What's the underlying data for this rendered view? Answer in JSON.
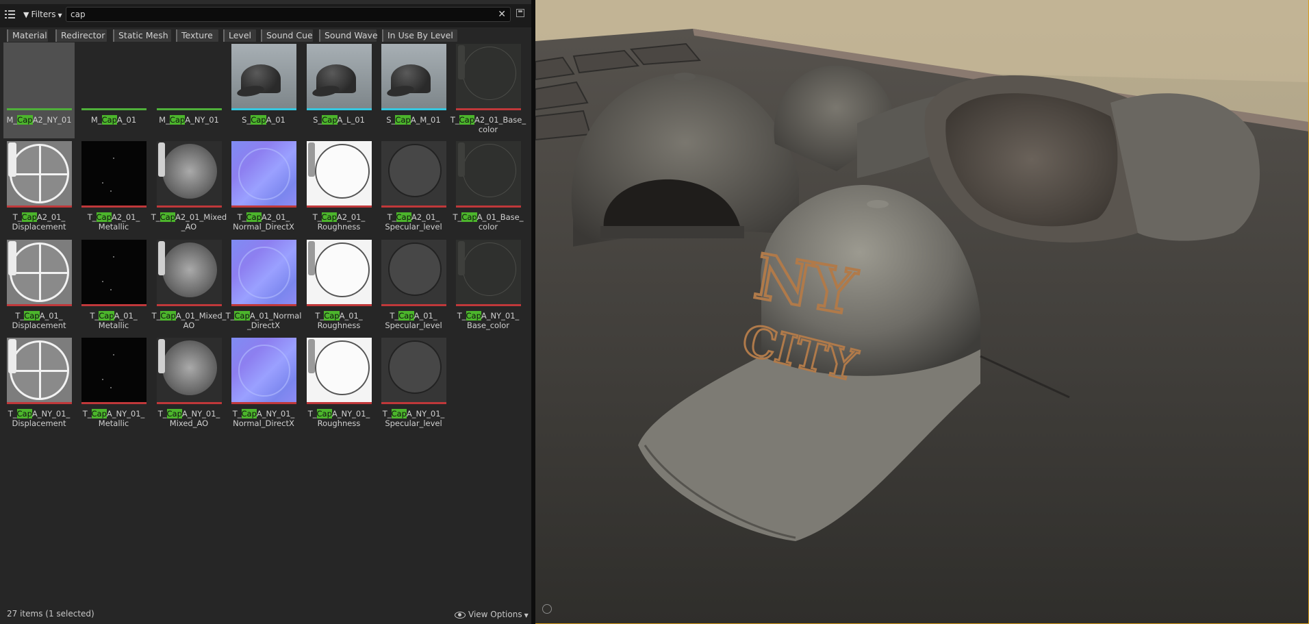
{
  "toolbar": {
    "filters_label": "Filters",
    "search_value": "cap",
    "search_placeholder": ""
  },
  "filter_chips": [
    {
      "label": "Material"
    },
    {
      "label": "Redirector"
    },
    {
      "label": "Static Mesh"
    },
    {
      "label": "Texture"
    },
    {
      "label": "Level"
    },
    {
      "label": "Sound Cue"
    },
    {
      "label": "Sound Wave"
    },
    {
      "label": "In Use By Level"
    }
  ],
  "assets": [
    {
      "pre": "M_",
      "match": "Cap",
      "post": "A2_NY_01",
      "thumb": "material",
      "bar": "#4fb03a",
      "selected": true
    },
    {
      "pre": "M_",
      "match": "Cap",
      "post": "A_01",
      "thumb": "material",
      "bar": "#4fb03a"
    },
    {
      "pre": "M_",
      "match": "Cap",
      "post": "A_NY_01",
      "thumb": "material",
      "bar": "#4fb03a"
    },
    {
      "pre": "S_",
      "match": "Cap",
      "post": "A_01",
      "thumb": "mesh",
      "bar": "#35c8e0"
    },
    {
      "pre": "S_",
      "match": "Cap",
      "post": "A_L_01",
      "thumb": "mesh",
      "bar": "#35c8e0"
    },
    {
      "pre": "S_",
      "match": "Cap",
      "post": "A_M_01",
      "thumb": "mesh",
      "bar": "#35c8e0"
    },
    {
      "pre": "T_",
      "match": "Cap",
      "post": "A2_01_Base_\ncolor",
      "thumb": "base",
      "bar": "#c0383a"
    },
    {
      "pre": "T_",
      "match": "Cap",
      "post": "A2_01_\nDisplacement",
      "thumb": "disp",
      "bar": "#c0383a"
    },
    {
      "pre": "T_",
      "match": "Cap",
      "post": "A2_01_\nMetallic",
      "thumb": "black",
      "bar": "#c0383a"
    },
    {
      "pre": "T_",
      "match": "Cap",
      "post": "A2_01_Mixed\n_AO",
      "thumb": "ao",
      "bar": "#c0383a"
    },
    {
      "pre": "T_",
      "match": "Cap",
      "post": "A2_01_\nNormal_DirectX",
      "thumb": "normal",
      "bar": "#c0383a"
    },
    {
      "pre": "T_",
      "match": "Cap",
      "post": "A2_01_\nRoughness",
      "thumb": "rough",
      "bar": "#c0383a"
    },
    {
      "pre": "T_",
      "match": "Cap",
      "post": "A2_01_\nSpecular_level",
      "thumb": "spec",
      "bar": "#c0383a"
    },
    {
      "pre": "T_",
      "match": "Cap",
      "post": "A_01_Base_\ncolor",
      "thumb": "base",
      "bar": "#c0383a"
    },
    {
      "pre": "T_",
      "match": "Cap",
      "post": "A_01_\nDisplacement",
      "thumb": "disp",
      "bar": "#c0383a"
    },
    {
      "pre": "T_",
      "match": "Cap",
      "post": "A_01_\nMetallic",
      "thumb": "black",
      "bar": "#c0383a"
    },
    {
      "pre": "T_",
      "match": "Cap",
      "post": "A_01_Mixed_\nAO",
      "thumb": "ao",
      "bar": "#c0383a"
    },
    {
      "pre": "T_",
      "match": "Cap",
      "post": "A_01_Normal\n_DirectX",
      "thumb": "normal",
      "bar": "#c0383a"
    },
    {
      "pre": "T_",
      "match": "Cap",
      "post": "A_01_\nRoughness",
      "thumb": "rough",
      "bar": "#c0383a"
    },
    {
      "pre": "T_",
      "match": "Cap",
      "post": "A_01_\nSpecular_level",
      "thumb": "spec",
      "bar": "#c0383a"
    },
    {
      "pre": "T_",
      "match": "Cap",
      "post": "A_NY_01_\nBase_color",
      "thumb": "base",
      "bar": "#c0383a"
    },
    {
      "pre": "T_",
      "match": "Cap",
      "post": "A_NY_01_\nDisplacement",
      "thumb": "disp",
      "bar": "#c0383a"
    },
    {
      "pre": "T_",
      "match": "Cap",
      "post": "A_NY_01_\nMetallic",
      "thumb": "black",
      "bar": "#c0383a"
    },
    {
      "pre": "T_",
      "match": "Cap",
      "post": "A_NY_01_\nMixed_AO",
      "thumb": "ao",
      "bar": "#c0383a"
    },
    {
      "pre": "T_",
      "match": "Cap",
      "post": "A_NY_01_\nNormal_DirectX",
      "thumb": "normal",
      "bar": "#c0383a"
    },
    {
      "pre": "T_",
      "match": "Cap",
      "post": "A_NY_01_\nRoughness",
      "thumb": "rough",
      "bar": "#c0383a"
    },
    {
      "pre": "T_",
      "match": "Cap",
      "post": "A_NY_01_\nSpecular_level",
      "thumb": "spec",
      "bar": "#c0383a"
    }
  ],
  "status": {
    "item_count": "27 items (1 selected)",
    "view_options": "View Options"
  },
  "viewport": {
    "cap_text_line1": "NY",
    "cap_text_line2": "CITY",
    "accent": "#d79b19"
  },
  "icons": {
    "menu": "content-browser-toggle-icon",
    "filters": "funnel-icon",
    "clear": "close-icon",
    "save": "save-search-icon",
    "view": "eye-icon"
  }
}
